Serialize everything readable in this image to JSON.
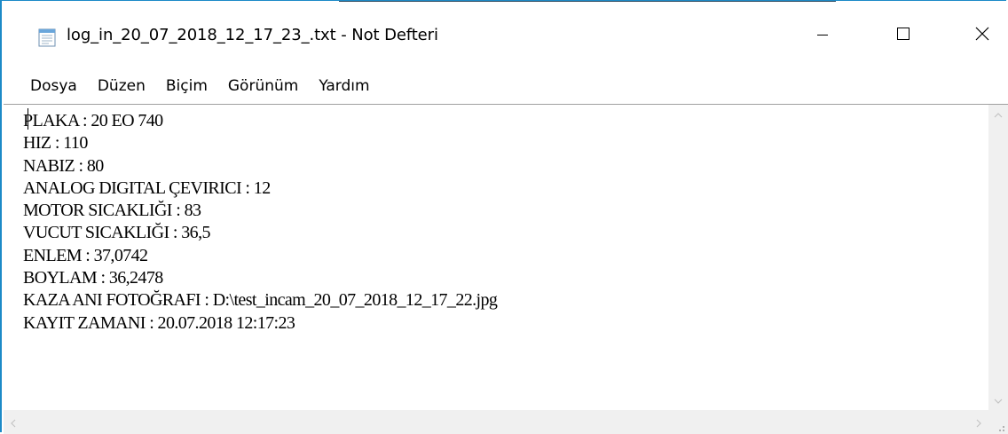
{
  "window": {
    "title": "log_in_20_07_2018_12_17_23_.txt - Not Defteri",
    "icon": "notepad-icon",
    "controls": {
      "minimize_icon": "minimize-icon",
      "maximize_icon": "maximize-icon",
      "close_icon": "close-icon"
    }
  },
  "menu": {
    "items": [
      {
        "label": "Dosya"
      },
      {
        "label": "Düzen"
      },
      {
        "label": "Biçim"
      },
      {
        "label": "Görünüm"
      },
      {
        "label": "Yardım"
      }
    ]
  },
  "editor": {
    "lines": [
      "PLAKA : 20 EO 740",
      "HIZ : 110",
      "NABIZ : 80",
      "ANALOG DIGITAL ÇEVIRICI : 12",
      "MOTOR SICAKLIĞI : 83",
      "VUCUT SICAKLIĞI : 36,5",
      "ENLEM : 37,0742",
      "BOYLAM : 36,2478",
      "KAZA ANI FOTOĞRAFI : D:\\test_incam_20_07_2018_12_17_22.jpg",
      "KAYIT ZAMANI : 20.07.2018 12:17:23"
    ]
  },
  "colors": {
    "window_border": "#1c8ac7",
    "scrollbar_bg": "#f0f0f0",
    "text": "#000000"
  }
}
